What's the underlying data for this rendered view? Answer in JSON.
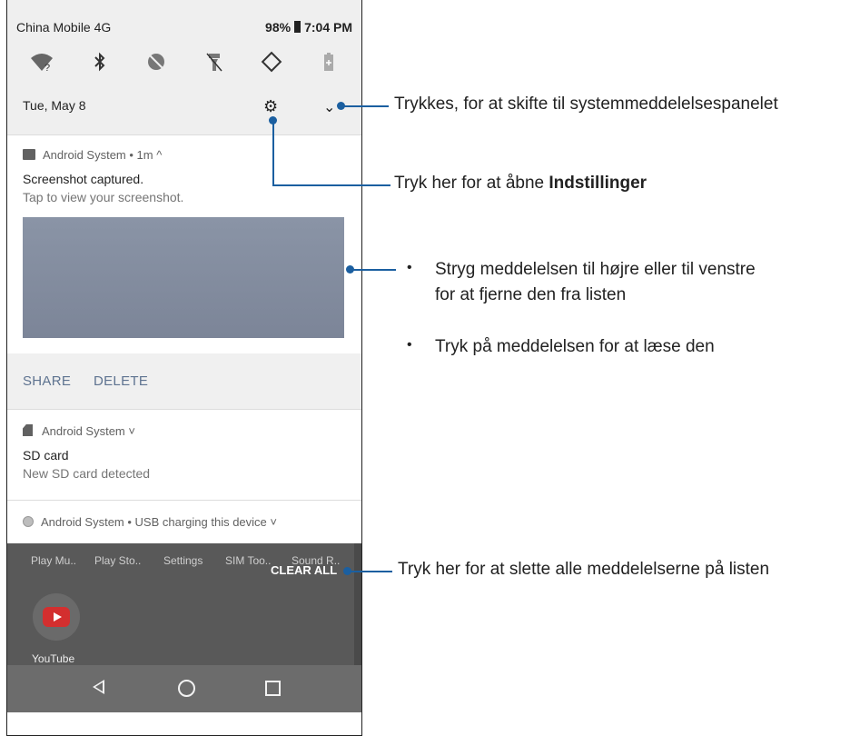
{
  "status": {
    "carrier": "China Mobile 4G",
    "battery": "98%",
    "time": "7:04 PM"
  },
  "quick_settings_icons": [
    "wifi-icon",
    "bluetooth-icon",
    "do-not-disturb-icon",
    "flashlight-icon",
    "auto-rotate-icon",
    "battery-saver-icon"
  ],
  "header": {
    "date": "Tue, May 8",
    "settings_icon": "gear-icon",
    "expand_icon": "chevron-down-icon"
  },
  "notification_screenshot": {
    "app_line": "Android System • 1m ^",
    "title": "Screenshot captured.",
    "text": "Tap to view your screenshot.",
    "actions": [
      "SHARE",
      "DELETE"
    ]
  },
  "notification_sd": {
    "app_line": "Android System ˅",
    "title": "SD card",
    "text": "New SD card detected"
  },
  "notification_usb": {
    "app_line": "Android System • USB charging this device ˅"
  },
  "recents": {
    "apps": [
      "Play Mu..",
      "Play Sto..",
      "Settings",
      "SIM Too..",
      "Sound R.."
    ],
    "clear_all": "CLEAR ALL",
    "youtube_label": "YouTube"
  },
  "navbar": [
    "back-icon",
    "home-icon",
    "recents-icon"
  ],
  "callouts": {
    "expand": "Trykkes, for at skifte til systemmeddelelsespanelet",
    "settings_prefix": "Tryk her for at åbne ",
    "settings_bold": "Indstillinger",
    "swipe_line1": "Stryg meddelelsen til højre eller til venstre",
    "swipe_line2": "for at fjerne den fra listen",
    "tap_read": "Tryk på meddelelsen for at læse den",
    "clear_all": "Tryk her for at slette alle meddelelserne på listen"
  },
  "colors": {
    "callout_line": "#1b5fa0",
    "action_text": "#5e7390"
  }
}
